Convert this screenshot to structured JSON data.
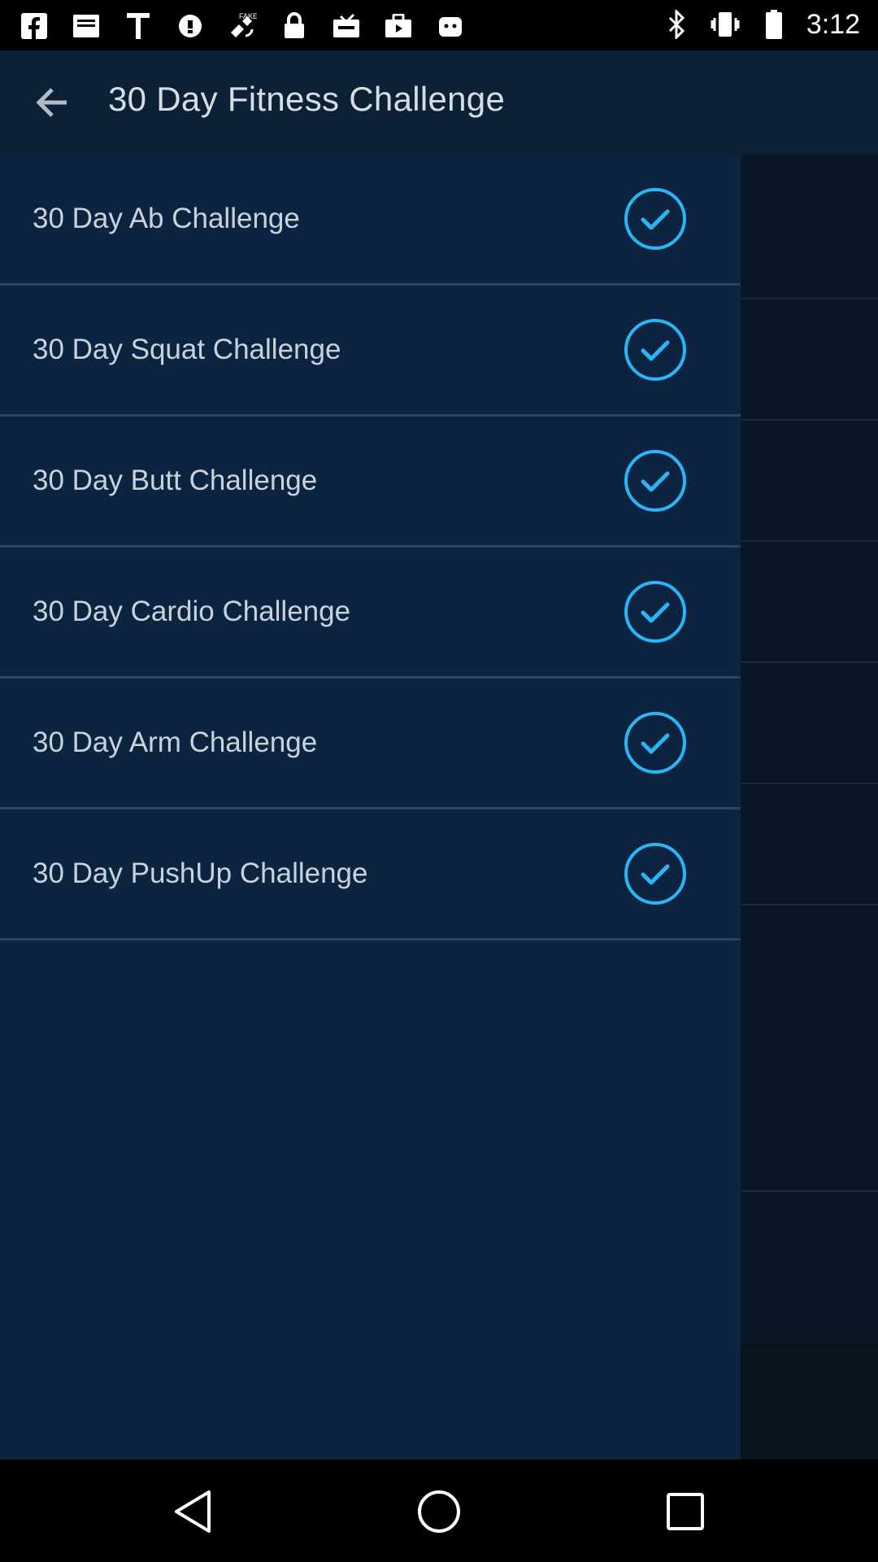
{
  "status_bar": {
    "time": "3:12",
    "left_icons": [
      "facebook-icon",
      "notification-icon",
      "text-icon",
      "help-icon",
      "fake-gps-icon",
      "lock-icon",
      "inbox-icon",
      "briefcase-icon",
      "android-icon"
    ],
    "right_icons": [
      "bluetooth-icon",
      "vibrate-icon",
      "battery-icon"
    ]
  },
  "app_bar": {
    "title": "30 Day Fitness Challenge",
    "back_icon": "arrow-back-icon"
  },
  "drawer": {
    "items": [
      {
        "label": "30 Day Ab Challenge",
        "completed": true
      },
      {
        "label": "30 Day Squat Challenge",
        "completed": true
      },
      {
        "label": "30 Day Butt Challenge",
        "completed": true
      },
      {
        "label": "30 Day Cardio Challenge",
        "completed": true
      },
      {
        "label": "30 Day Arm Challenge",
        "completed": true
      },
      {
        "label": "30 Day PushUp Challenge",
        "completed": true
      }
    ]
  },
  "background": {
    "more_icon": "more-dots-icon"
  },
  "nav_bar": {
    "back": "nav-back-icon",
    "home": "nav-home-icon",
    "recents": "nav-recents-icon"
  },
  "colors": {
    "app_bar_bg": "#0c2136",
    "drawer_bg": "#0c2440",
    "accent": "#29b6f6",
    "text": "#c9d2dc"
  }
}
